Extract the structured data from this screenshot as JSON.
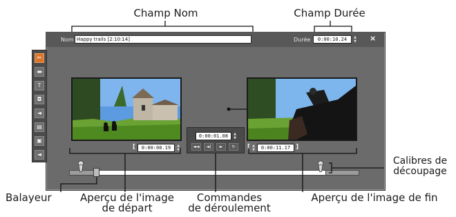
{
  "callouts": {
    "champ_nom": "Champ Nom",
    "champ_duree": "Champ Durée",
    "calibres_line1": "Calibres de",
    "calibres_line2": "découpage",
    "balayeur": "Balayeur",
    "apercu_depart_line1": "Aperçu de l'image",
    "apercu_depart_line2": "de départ",
    "commandes_line1": "Commandes",
    "commandes_line2": "de déroulement",
    "apercu_fin": "Aperçu de l'image de fin"
  },
  "header": {
    "name_label": "Nom",
    "name_value": "Happy trails [2:10:14]",
    "duration_label": "Durée",
    "duration_value": "0:00:10.24",
    "close_glyph": "×"
  },
  "toolbar": {
    "tools": [
      {
        "name": "scissors-icon",
        "glyph": "✂"
      },
      {
        "name": "video-icon",
        "glyph": "▬"
      },
      {
        "name": "text-icon",
        "glyph": "T"
      },
      {
        "name": "effects-icon",
        "glyph": "◘"
      },
      {
        "name": "audio-icon",
        "glyph": "◄"
      },
      {
        "name": "clip-icon",
        "glyph": "▤"
      },
      {
        "name": "image-icon",
        "glyph": "▣"
      },
      {
        "name": "speaker-icon",
        "glyph": "◄"
      }
    ]
  },
  "start_preview": {
    "timecode": "0:00:00.19"
  },
  "transport": {
    "timecode": "0:00:01.08",
    "buttons": [
      "◄◄",
      "◄|",
      "►",
      "↻"
    ]
  },
  "end_preview": {
    "timecode": "0:00:11.17"
  }
}
